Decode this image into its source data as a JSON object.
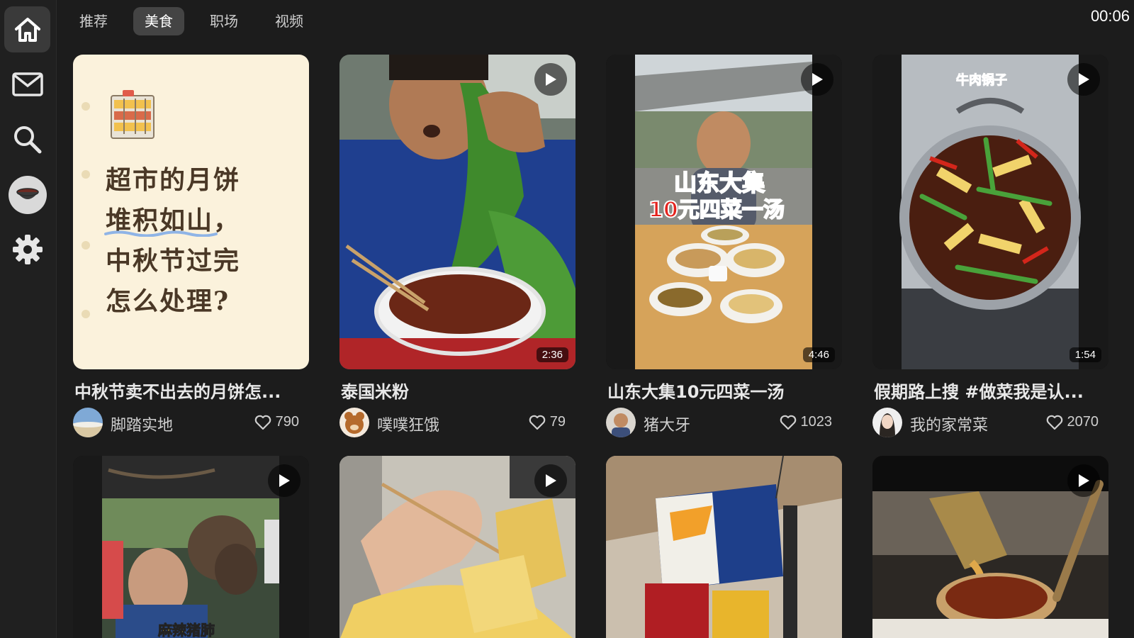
{
  "status": {
    "time": "00:06"
  },
  "sidebar": {
    "items": [
      {
        "icon": "home-icon",
        "active": true
      },
      {
        "icon": "mail-icon"
      },
      {
        "icon": "search-icon"
      },
      {
        "icon": "bowl-icon"
      },
      {
        "icon": "gear-icon"
      }
    ]
  },
  "tabs": [
    {
      "label": "推荐"
    },
    {
      "label": "美食",
      "active": true
    },
    {
      "label": "职场"
    },
    {
      "label": "视频"
    }
  ],
  "feed": {
    "row1": [
      {
        "title": "中秋节卖不出去的月饼怎...",
        "author": "脚踏实地",
        "likes": "790",
        "thumb_text": [
          "超市的月饼",
          "堆积如山，",
          "中秋节过完",
          "怎么处理?"
        ]
      },
      {
        "title": "泰国米粉",
        "author": "噗噗狂饿",
        "likes": "79",
        "duration": "2:36"
      },
      {
        "title": "山东大集10元四菜一汤",
        "author": "猪大牙",
        "likes": "1023",
        "duration": "4:46",
        "overlay_line1": "山东大集",
        "overlay_line2": "10元四菜一汤"
      },
      {
        "title": "假期路上搜 #做菜我是认...",
        "author": "我的家常菜",
        "likes": "2070",
        "duration": "1:54",
        "overlay": "牛肉锅子"
      }
    ],
    "row2": [
      {
        "overlay": "麻辣猪肺"
      },
      {},
      {},
      {}
    ]
  },
  "colors": {
    "background": "#1c1c1c",
    "sidebar": "#202020",
    "active_tab": "#444444",
    "note_bg": "#fbf2dc",
    "note_text": "#4a3826"
  }
}
